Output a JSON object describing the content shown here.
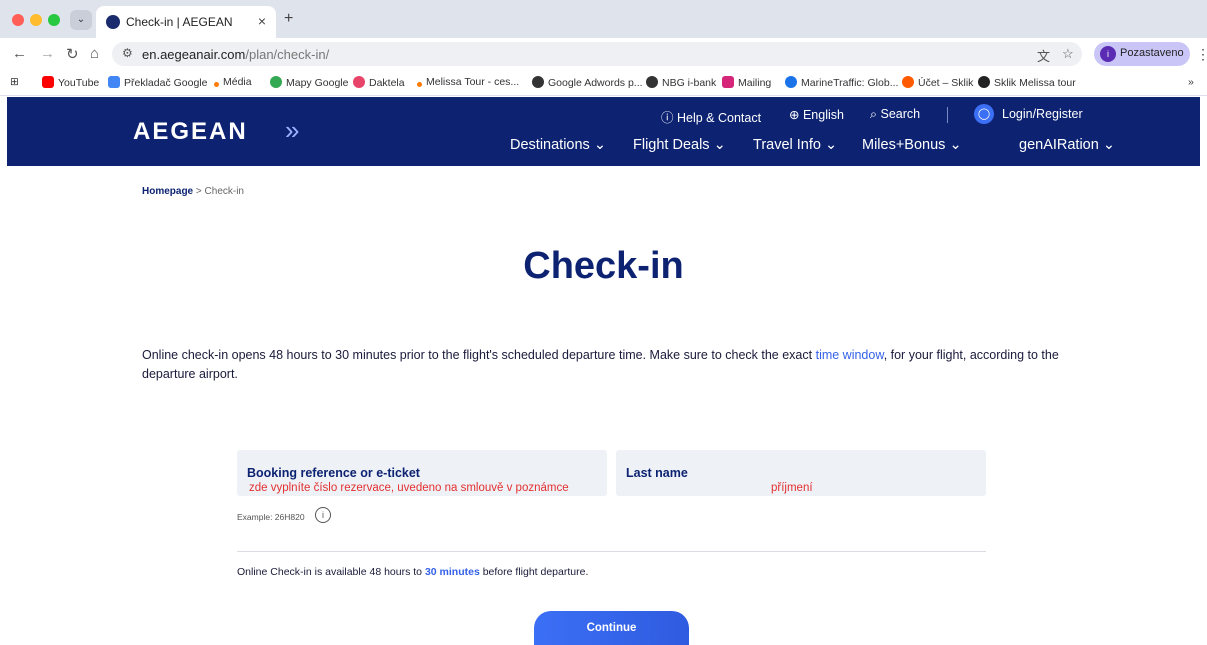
{
  "browser": {
    "tab_title": "Check-in | AEGEAN",
    "tab_close": "×",
    "new_tab": "+",
    "tab_menu": "⌄",
    "url_host": "en.aegeanair.com",
    "url_path": "/plan/check-in/",
    "profile_initial": "i",
    "profile_label": "Pozastaveno",
    "bookmarks": [
      {
        "label": "YouTube",
        "color": "#ff0000"
      },
      {
        "label": "Překladač Google",
        "color": "#4285f4"
      },
      {
        "label": "Média",
        "color": "#ff7a00"
      },
      {
        "label": "Mapy Google",
        "color": "#34a853"
      },
      {
        "label": "Daktela",
        "color": "#e8446a"
      },
      {
        "label": "Melissa Tour - ces...",
        "color": "#ff7a00"
      },
      {
        "label": "Google Adwords p...",
        "color": "#333333"
      },
      {
        "label": "NBG i-bank",
        "color": "#333333"
      },
      {
        "label": "Mailing",
        "color": "#d6267a"
      },
      {
        "label": "MarineTraffic: Glob...",
        "color": "#1a73e8"
      },
      {
        "label": "Účet – Sklik",
        "color": "#ff5a00"
      },
      {
        "label": "Sklik Melissa tour",
        "color": "#222222"
      }
    ],
    "bookmarks_more": "»"
  },
  "header": {
    "logo": "AEGEAN",
    "help": "Help & Contact",
    "language": "English",
    "search": "Search",
    "login": "Login/Register",
    "menu": [
      "Destinations ⌄",
      "Flight Deals ⌄",
      "Travel Info ⌄",
      "Miles+Bonus ⌄",
      "genAIRation ⌄"
    ]
  },
  "breadcrumb": {
    "home": "Homepage",
    "separator": ">",
    "current": "Check-in"
  },
  "page": {
    "title": "Check-in",
    "intro_before": "Online check-in opens 48 hours to 30 minutes prior to the flight's scheduled departure time. Make sure to check the exact ",
    "intro_link": "time window",
    "intro_after": ", for your flight, according to the departure airport."
  },
  "form": {
    "booking_label": "Booking reference or e-ticket",
    "booking_note": "zde vyplníte číslo rezervace, uvedeno na smlouvě v poznámce",
    "lastname_label": "Last name",
    "lastname_note": "příjmení",
    "example": "Example: 26H820",
    "availability_before": "Online Check-in is available 48 hours to ",
    "availability_bold": "30 minutes",
    "availability_after": " before flight departure.",
    "continue": "Continue"
  }
}
